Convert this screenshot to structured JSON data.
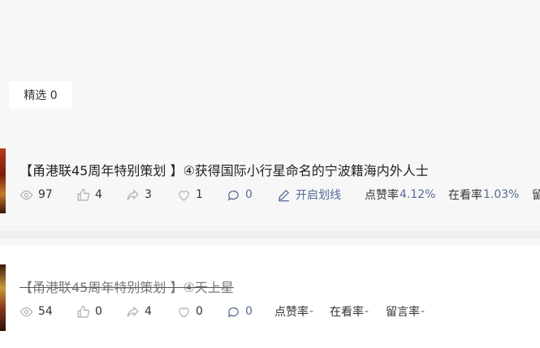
{
  "tab": {
    "label": "精选 0"
  },
  "articles": [
    {
      "title": "【甬港联45周年特别策划 】④获得国际小行星命名的宁波籍海内外人士",
      "views": "97",
      "likes": "4",
      "shares": "3",
      "favorites": "1",
      "comments": "0",
      "underline_action": "开启划线",
      "like_rate_label": "点赞率",
      "like_rate": "4.12%",
      "watching_rate_label": "在看率",
      "watching_rate": "1.03%",
      "comment_rate_label": "留"
    },
    {
      "title": "【甬港联45周年特别策划 】④天上星",
      "views": "54",
      "likes": "0",
      "shares": "4",
      "favorites": "0",
      "comments": "0",
      "like_rate_label": "点赞率",
      "like_rate": "-",
      "watching_rate_label": "在看率",
      "watching_rate": "-",
      "comment_rate_label": "留言率",
      "comment_rate": "-"
    }
  ],
  "colors": {
    "accent": "#576b95",
    "background": "#f5f6f7"
  }
}
